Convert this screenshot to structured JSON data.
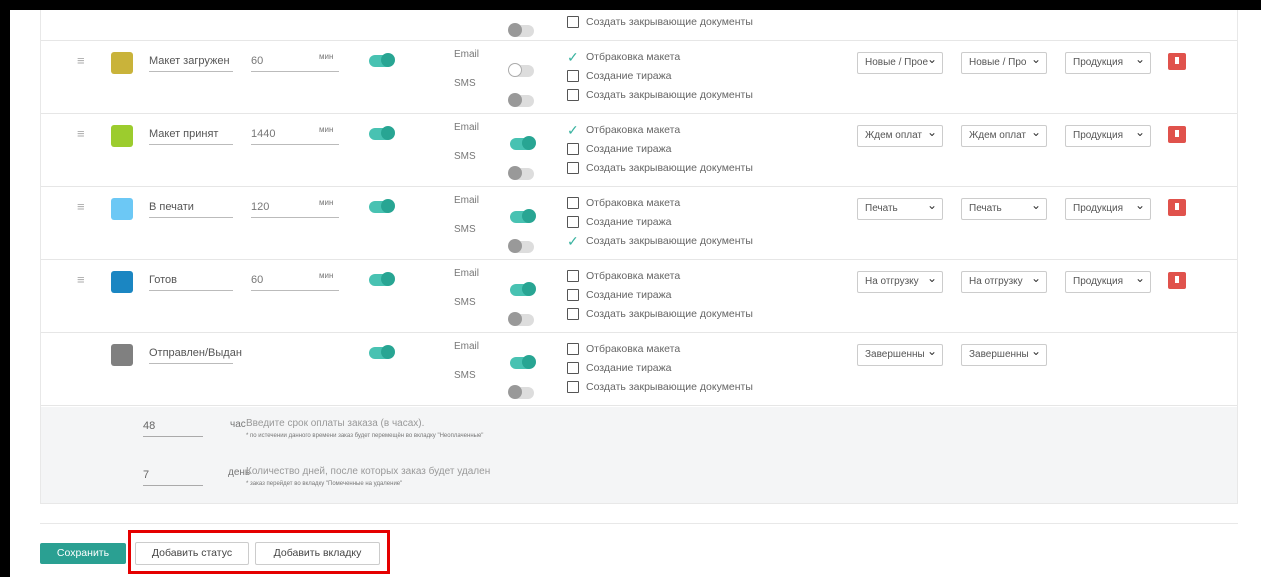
{
  "top_row": {
    "check_label": "Создать закрывающие документы"
  },
  "statuses": [
    {
      "name": "Макет загружен",
      "minutes": "60",
      "unit": "мин",
      "color": "#c9b33a",
      "main_toggle": "on",
      "email_label": "Email",
      "sms_label": "SMS",
      "email_toggle": "off-white",
      "sms_toggle": "off",
      "checks": [
        {
          "label": "Отбраковка макета",
          "checked": true
        },
        {
          "label": "Создание тиража",
          "checked": false
        },
        {
          "label": "Создать закрывающие документы",
          "checked": false
        }
      ],
      "select1": "Новые / Прое",
      "select2": "Новые / Про",
      "select3": "Продукция",
      "deletable": true
    },
    {
      "name": "Макет принят",
      "minutes": "1440",
      "unit": "мин",
      "color": "#9ccc2e",
      "main_toggle": "on",
      "email_label": "Email",
      "sms_label": "SMS",
      "email_toggle": "on",
      "sms_toggle": "off",
      "checks": [
        {
          "label": "Отбраковка макета",
          "checked": true
        },
        {
          "label": "Создание тиража",
          "checked": false
        },
        {
          "label": "Создать закрывающие документы",
          "checked": false
        }
      ],
      "select1": "Ждем оплат",
      "select2": "Ждем оплат",
      "select3": "Продукция",
      "deletable": true
    },
    {
      "name": "В печати",
      "minutes": "120",
      "unit": "мин",
      "color": "#6cc8f5",
      "main_toggle": "on",
      "email_label": "Email",
      "sms_label": "SMS",
      "email_toggle": "on",
      "sms_toggle": "off",
      "checks": [
        {
          "label": "Отбраковка макета",
          "checked": false
        },
        {
          "label": "Создание тиража",
          "checked": false
        },
        {
          "label": "Создать закрывающие документы",
          "checked": true
        }
      ],
      "select1": "Печать",
      "select2": "Печать",
      "select3": "Продукция",
      "deletable": true
    },
    {
      "name": "Готов",
      "minutes": "60",
      "unit": "мин",
      "color": "#1b86c2",
      "main_toggle": "on",
      "email_label": "Email",
      "sms_label": "SMS",
      "email_toggle": "on",
      "sms_toggle": "off",
      "checks": [
        {
          "label": "Отбраковка макета",
          "checked": false
        },
        {
          "label": "Создание тиража",
          "checked": false
        },
        {
          "label": "Создать закрывающие документы",
          "checked": false
        }
      ],
      "select1": "На отгрузку",
      "select2": "На отгрузку",
      "select3": "Продукция",
      "deletable": true
    },
    {
      "name": "Отправлен/Выдан",
      "minutes": "",
      "unit": "",
      "color": "#808080",
      "main_toggle": "on",
      "email_label": "Email",
      "sms_label": "SMS",
      "email_toggle": "on",
      "sms_toggle": "off",
      "checks": [
        {
          "label": "Отбраковка макета",
          "checked": false
        },
        {
          "label": "Создание тиража",
          "checked": false
        },
        {
          "label": "Создать закрывающие документы",
          "checked": false
        }
      ],
      "select1": "Завершенны",
      "select2": "Завершенны",
      "select3": "",
      "deletable": false
    }
  ],
  "settings": {
    "payment_value": "48",
    "payment_unit": "час",
    "payment_hint": "Введите срок оплаты заказа (в часах).",
    "payment_note": "* по истечении данного времени заказ будет перемещён во вкладку \"Неоплаченные\"",
    "delete_value": "7",
    "delete_unit": "день",
    "delete_hint": "Количество дней, после которых заказ будет удален",
    "delete_note": "* заказ перейдет во вкладку \"Помеченные на удаление\""
  },
  "buttons": {
    "save": "Сохранить",
    "add_status": "Добавить статус",
    "add_tab": "Добавить вкладку"
  },
  "colors": {
    "accent": "#2aa092",
    "delete": "#e0524c",
    "highlight": "#e50000"
  }
}
